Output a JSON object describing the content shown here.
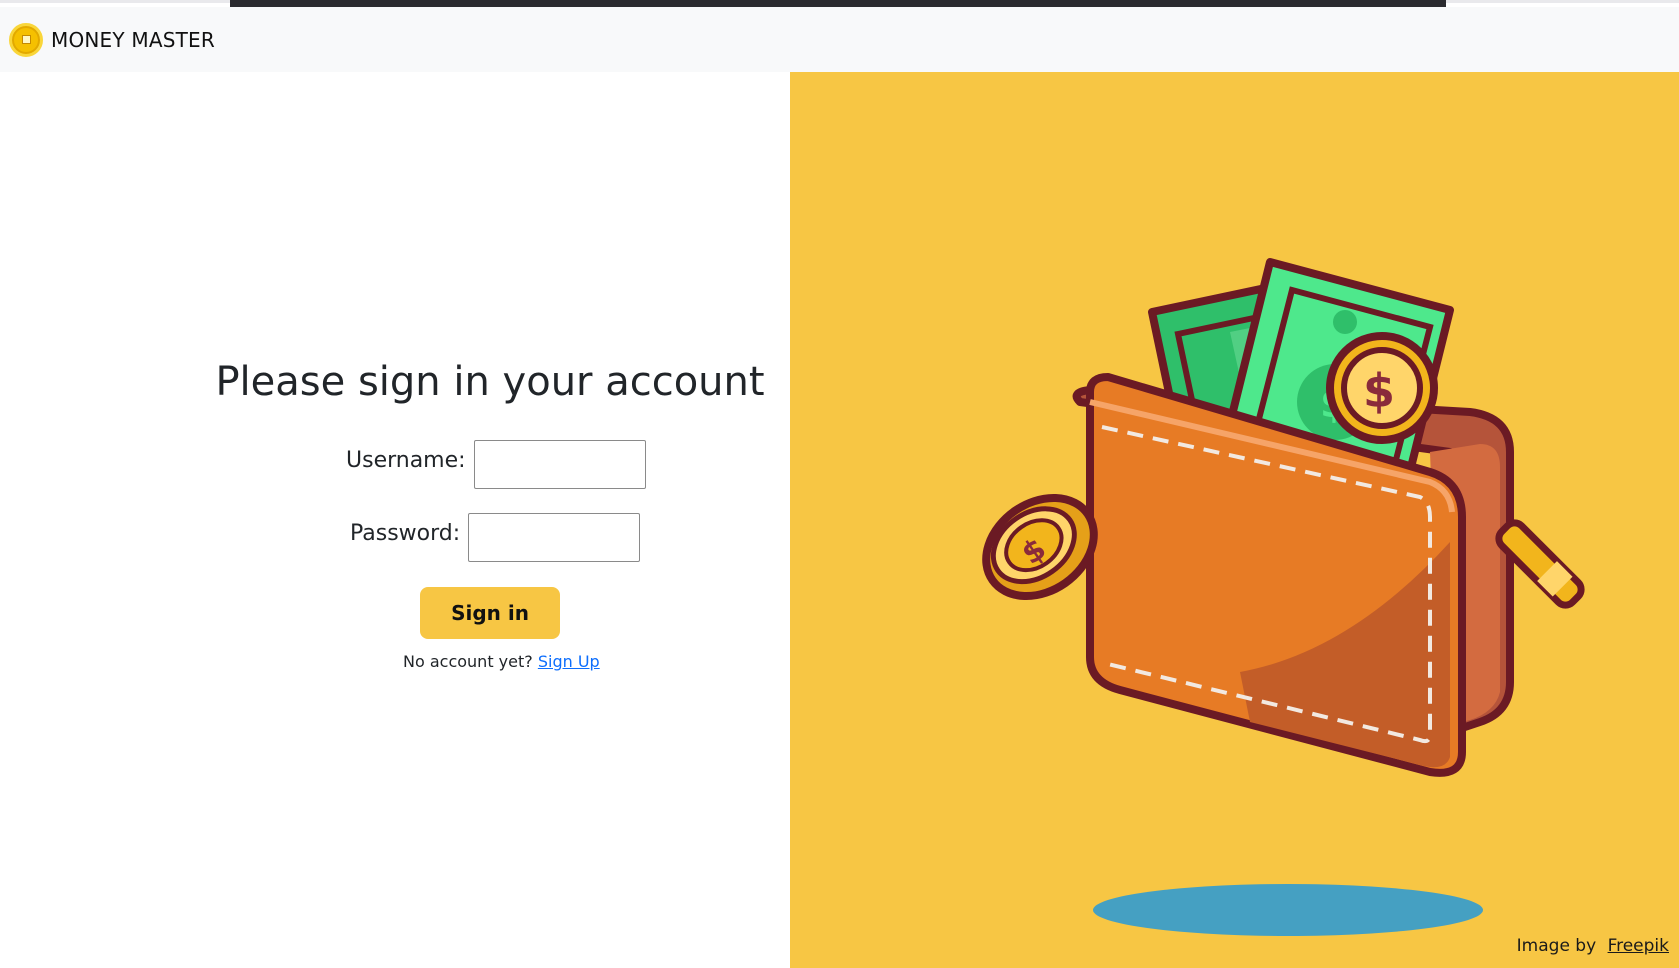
{
  "header": {
    "brand_name": "MONEY MASTER",
    "logo_icon": "gold-coin-icon"
  },
  "login": {
    "title": "Please sign in your account",
    "username_label": "Username:",
    "username_value": "",
    "password_label": "Password:",
    "password_value": "",
    "submit_label": "Sign in",
    "no_account_text": "No account yet?",
    "signup_link": "Sign Up"
  },
  "illustration": {
    "icon": "wallet-with-money-illustration",
    "credit_prefix": "Image by",
    "credit_link": "Freepik"
  },
  "colors": {
    "accent_yellow": "#f7c644",
    "link_blue": "#0d6efd",
    "navbar_bg": "#f8f9fa"
  }
}
